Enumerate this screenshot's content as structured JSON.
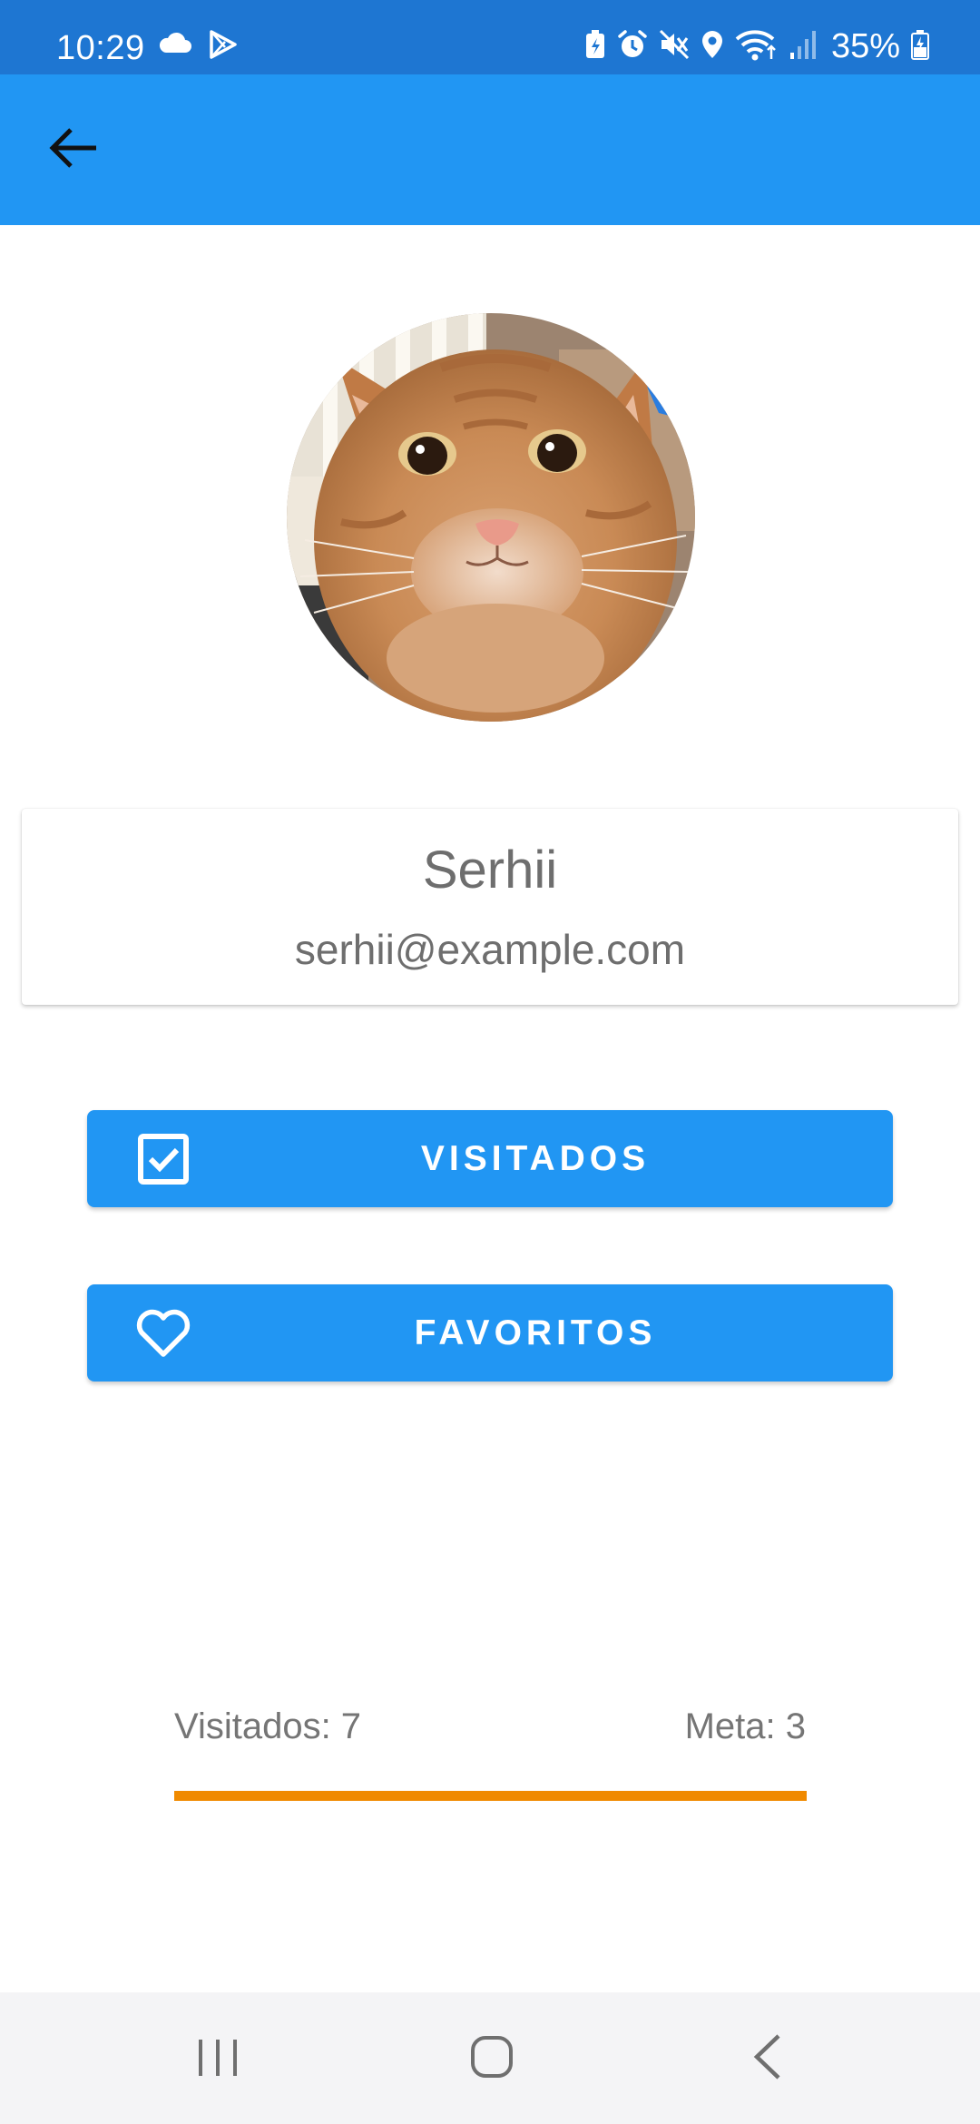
{
  "status_bar": {
    "time": "10:29",
    "battery": "35%",
    "left_icons": [
      "cloud-icon",
      "play-store-icon"
    ],
    "right_icons": [
      "battery-saver-icon",
      "alarm-icon",
      "mute-icon",
      "location-icon",
      "wifi-icon",
      "signal-icon",
      "battery-icon"
    ]
  },
  "app_bar": {
    "back_icon": "arrow-back-icon",
    "color": "#2196f3"
  },
  "profile": {
    "name": "Serhii",
    "email": "serhii@example.com",
    "avatar": "cat-photo"
  },
  "actions": {
    "visitados_label": "VISITADOS",
    "visitados_icon": "checkbox-checked-icon",
    "favoritos_label": "FAVORITOS",
    "favoritos_icon": "heart-outline-icon"
  },
  "stats": {
    "visited_text": "Visitados: 7",
    "goal_text": "Meta: 3",
    "progress_fraction": 1.0,
    "progress_color": "#f08a00"
  },
  "nav_bar": {
    "icons": [
      "recents-icon",
      "home-icon",
      "back-icon"
    ]
  }
}
